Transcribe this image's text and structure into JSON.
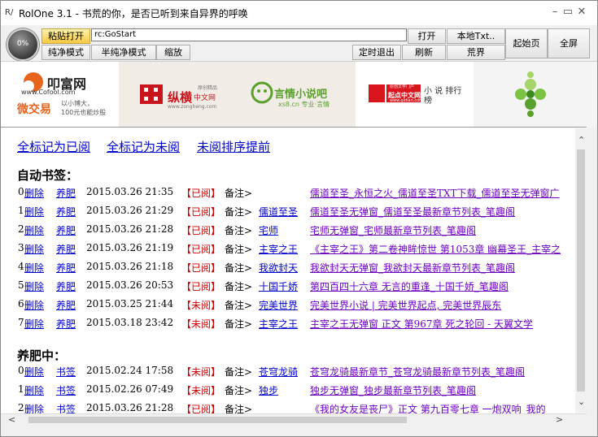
{
  "window": {
    "title": "RolOne 3.1 - 书荒的你，是否已听到来自异界的呼唤",
    "app_icon": "R/"
  },
  "toolbar": {
    "progress": "0%",
    "paste_open": "粘贴打开",
    "url_value": "rc:GoStart",
    "pure_mode": "纯净模式",
    "semi_pure_mode": "半纯净模式",
    "zoom": "缩放",
    "open": "打开",
    "local_txt": "本地Txt..",
    "start_page": "起始页",
    "fullscreen": "全屏",
    "timed_exit": "定时退出",
    "refresh": "刷新",
    "shortage": "荒界"
  },
  "banner": {
    "ad1_brand": "叩富网",
    "ad1_url": "www.Cofool.com",
    "ad1_slogan_main": "微交易",
    "ad1_slogan_sub1": "以小博大，",
    "ad1_slogan_sub2": "100元也能炒股",
    "ad2_brand": "纵横",
    "ad2_sub": "中文网",
    "ad2_tag": "原创精品",
    "ad2_url": "www.zongheng.com",
    "ad3_brand": "言情小说吧",
    "ad3_url": "xs8.cn 专业·言情",
    "ad4_brand": "起点中文网",
    "ad4_rank": "小 说 排行榜",
    "ad4_tag": "原创文学门户",
    "ad4_url": "www.qidian.com"
  },
  "content": {
    "mark_all_read": "全标记为已阅",
    "mark_all_unread": "全标记为未阅",
    "sort_unread": "未阅排序提前",
    "auto_bookmarks_title": "自动书签：",
    "pending_title": "养肥中：",
    "auto_rows": [
      {
        "idx": "0",
        "del": "删除",
        "act": "养肥",
        "date": "2015.03.26 21:35",
        "status": "【已阅】",
        "note": "备注>",
        "note_link": "",
        "title": "儒道至圣_永恒之火_儒道至圣TXT下载_儒道至圣无弹窗广"
      },
      {
        "idx": "1",
        "del": "删除",
        "act": "养肥",
        "date": "2015.03.26 21:29",
        "status": "【已阅】",
        "note": "备注>",
        "note_link": "儒道至圣",
        "title": "儒道至圣无弹窗_儒道至圣最新章节列表_笔趣阁"
      },
      {
        "idx": "2",
        "del": "删除",
        "act": "养肥",
        "date": "2015.03.26 21:28",
        "status": "【已阅】",
        "note": "备注>",
        "note_link": "宅师",
        "title": "宅师无弹窗_宅师最新章节列表_笔趣阁"
      },
      {
        "idx": "3",
        "del": "删除",
        "act": "养肥",
        "date": "2015.03.26 21:19",
        "status": "【已阅】",
        "note": "备注>",
        "note_link": "主宰之王",
        "title": "《主宰之王》第二卷神眸惊世 第1053章 幽幕圣王_主宰之"
      },
      {
        "idx": "4",
        "del": "删除",
        "act": "养肥",
        "date": "2015.03.26 21:18",
        "status": "【已阅】",
        "note": "备注>",
        "note_link": "我欲封天",
        "title": "我欲封天无弹窗_我欲封天最新章节列表_笔趣阁"
      },
      {
        "idx": "5",
        "del": "删除",
        "act": "养肥",
        "date": "2015.03.26 20:53",
        "status": "【已阅】",
        "note": "备注>",
        "note_link": "十国千娇",
        "title": "第四百四十六章 无言的重逢_十国千娇_笔趣阁"
      },
      {
        "idx": "6",
        "del": "删除",
        "act": "养肥",
        "date": "2015.03.25 21:44",
        "status": "【未阅】",
        "note": "备注>",
        "note_link": "完美世界",
        "title": "完美世界小说 | 完美世界起点, 完美世界辰东"
      },
      {
        "idx": "7",
        "del": "删除",
        "act": "养肥",
        "date": "2015.03.18 23:42",
        "status": "【未阅】",
        "note": "备注>",
        "note_link": "主宰之王",
        "title": "主宰之王无弹窗 正文 第967章 死之轮回 - 天翼文学"
      }
    ],
    "pending_rows": [
      {
        "idx": "0",
        "del": "删除",
        "act": "书签",
        "date": "2015.02.24 17:58",
        "status": "【未阅】",
        "note": "备注>",
        "note_link": "苍穹龙骑",
        "title": "苍穹龙骑最新章节_苍穹龙骑最新章节列表_笔趣阁"
      },
      {
        "idx": "1",
        "del": "删除",
        "act": "书签",
        "date": "2015.02.26 07:49",
        "status": "【未阅】",
        "note": "备注>",
        "note_link": "独步",
        "title": "独步无弹窗_独步最新章节列表_笔趣阁"
      },
      {
        "idx": "2",
        "del": "删除",
        "act": "书签",
        "date": "2015.03.26 21:28",
        "status": "【已阅】",
        "note": "备注>",
        "note_link": "",
        "title": "《我的女友是丧尸》正文 第九百零七章 一炮双响_我的"
      }
    ]
  }
}
